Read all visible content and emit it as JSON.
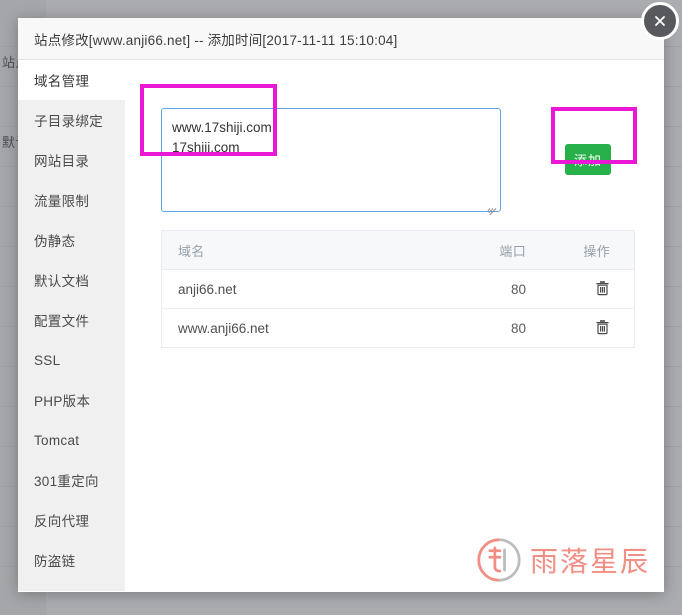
{
  "background": {
    "left_labels": [
      "站点时",
      "默认"
    ],
    "note": "dimmed page behind modal"
  },
  "modal": {
    "title": "站点修改[www.anji66.net] -- 添加时间[2017-11-11 15:10:04]",
    "close_label": "×",
    "sidebar": {
      "items": [
        {
          "label": "域名管理",
          "active": true
        },
        {
          "label": "子目录绑定",
          "active": false
        },
        {
          "label": "网站目录",
          "active": false
        },
        {
          "label": "流量限制",
          "active": false
        },
        {
          "label": "伪静态",
          "active": false
        },
        {
          "label": "默认文档",
          "active": false
        },
        {
          "label": "配置文件",
          "active": false
        },
        {
          "label": "SSL",
          "active": false
        },
        {
          "label": "PHP版本",
          "active": false
        },
        {
          "label": "Tomcat",
          "active": false
        },
        {
          "label": "301重定向",
          "active": false
        },
        {
          "label": "反向代理",
          "active": false
        },
        {
          "label": "防盗链",
          "active": false
        }
      ]
    },
    "domain_input": {
      "value": "www.17shiji.com\n17shiji.com",
      "placeholder": ""
    },
    "add_button": {
      "label": "添加"
    },
    "table": {
      "columns": [
        "域名",
        "端口",
        "操作"
      ],
      "rows": [
        {
          "domain": "anji66.net",
          "port": "80",
          "action": "delete-icon"
        },
        {
          "domain": "www.anji66.net",
          "port": "80",
          "action": "delete-icon"
        }
      ]
    },
    "watermark": {
      "text": "雨落星辰",
      "logo": "yulo-circle-logo"
    }
  },
  "colors": {
    "accent_green": "#28b04a",
    "highlight_magenta": "#ea17d6",
    "focus_blue": "#5ba4e8",
    "watermark_salmon": "#f2897e",
    "sidebar_bg": "#f0f0f0",
    "header_bg": "#f8f8f8"
  }
}
